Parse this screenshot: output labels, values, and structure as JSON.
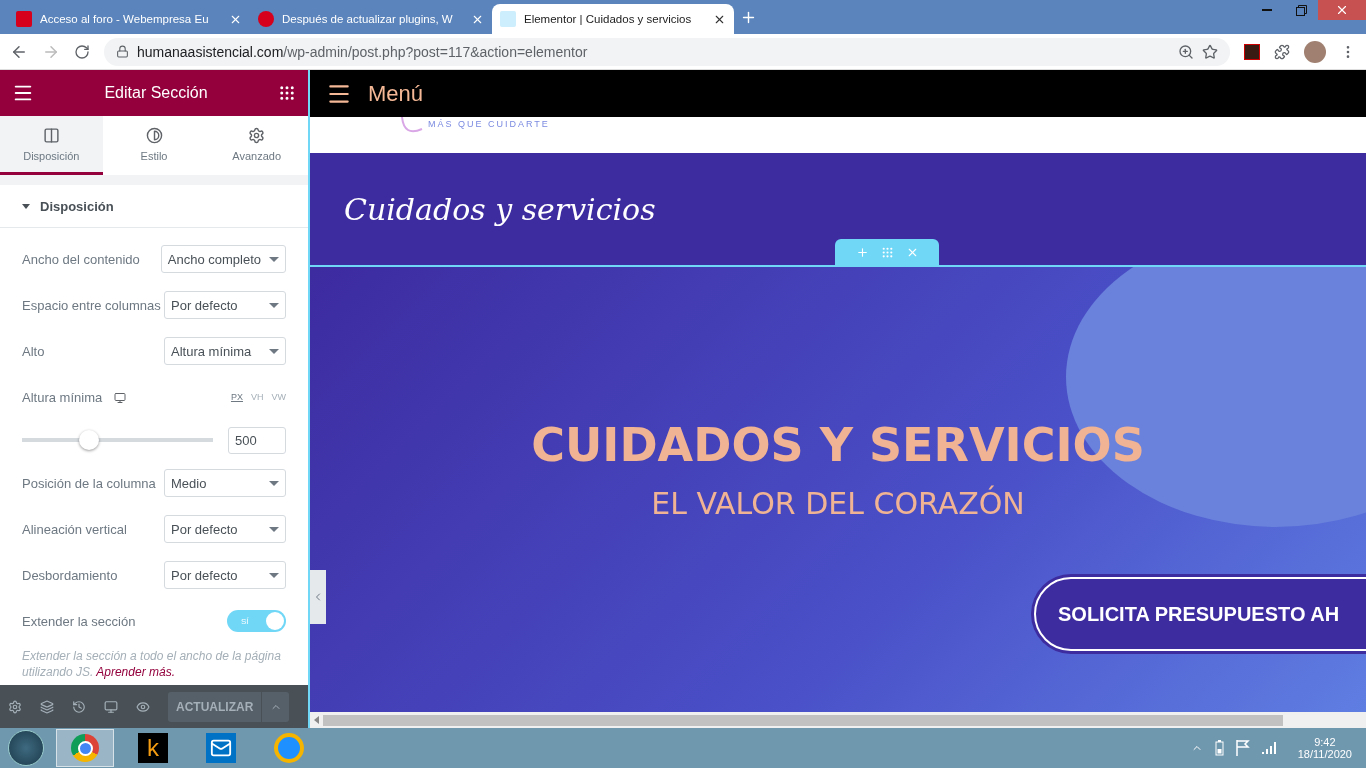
{
  "browser": {
    "tabs": [
      {
        "title": "Acceso al foro - Webempresa Eu",
        "kind": "w-square",
        "selected": false
      },
      {
        "title": "Después de actualizar plugins, W",
        "kind": "w-circle",
        "selected": false
      },
      {
        "title": "Elementor | Cuidados y servicios",
        "kind": "e-square",
        "selected": true
      }
    ],
    "url_host": "humanaasistencial.com",
    "url_path": "/wp-admin/post.php?post=117&action=elementor"
  },
  "panel": {
    "title": "Editar Sección",
    "tabs": [
      {
        "label": "Disposición",
        "kind": "columns",
        "selected": true
      },
      {
        "label": "Estilo",
        "kind": "contrast",
        "selected": false
      },
      {
        "label": "Avanzado",
        "kind": "gear",
        "selected": false
      }
    ],
    "section": {
      "title": "Disposición",
      "expanded": true
    },
    "controls": [
      {
        "kind": "select",
        "label": "Ancho del contenido",
        "value": "Ancho completo"
      },
      {
        "kind": "select",
        "label": "Espacio entre columnas",
        "value": "Por defecto"
      },
      {
        "kind": "select",
        "label": "Alto",
        "value": "Altura mínima"
      },
      {
        "kind": "slider",
        "label": "Altura mínima",
        "units": [
          {
            "label": "PX",
            "selected": true
          },
          {
            "label": "VH",
            "selected": false
          },
          {
            "label": "VW",
            "selected": false
          }
        ],
        "level": 0.35,
        "value": "500"
      },
      {
        "kind": "select",
        "label": "Posición de la columna",
        "value": "Medio"
      },
      {
        "kind": "select",
        "label": "Alineación vertical",
        "value": "Por defecto"
      },
      {
        "kind": "select",
        "label": "Desbordamiento",
        "value": "Por defecto"
      },
      {
        "kind": "toggle",
        "label": "Extender la sección",
        "on": true,
        "value": "SÍ"
      }
    ],
    "help_text": "Extender la sección a todo el ancho de la página utilizando JS.",
    "help_link": "Aprender más.",
    "update_button": "ACTUALIZAR"
  },
  "preview": {
    "menu_label": "Menú",
    "tagline": "MÁS QUE CUIDARTE",
    "page_title": "Cuidados y servicios",
    "hero_title": "CUIDADOS Y SERVICIOS",
    "hero_subtitle": "EL VALOR DEL CORAZÓN",
    "cta": "SOLICITA PRESUPUESTO AH"
  },
  "taskbar": {
    "apps": [
      {
        "kind": "chrome",
        "selected": true
      },
      {
        "kind": "k",
        "label": "k",
        "selected": false
      },
      {
        "kind": "mail",
        "selected": false
      },
      {
        "kind": "ie",
        "selected": false
      }
    ],
    "time": "9:42",
    "date": "18/11/2020"
  }
}
